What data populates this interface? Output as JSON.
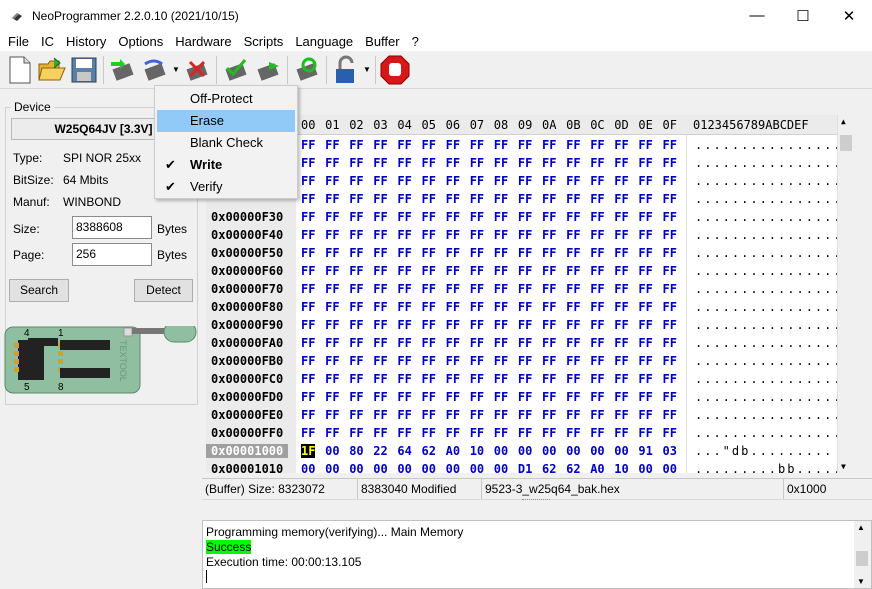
{
  "window": {
    "title": "NeoProgrammer 2.2.0.10 (2021/10/15)",
    "minimize_glyph": "—",
    "maximize_glyph": "☐",
    "close_glyph": "✕"
  },
  "menubar": {
    "items": [
      "File",
      "IC",
      "History",
      "Options",
      "Hardware",
      "Scripts",
      "Language",
      "Buffer",
      "?"
    ]
  },
  "toolbar": {
    "icons": [
      "new-file-icon",
      "open-folder-icon",
      "save-floppy-icon",
      "read-chip-icon",
      "write-chip-icon",
      "erase-chip-icon",
      "verify-chip-icon",
      "blank-check-icon",
      "auto-program-icon",
      "protect-lock-icon",
      "stop-icon"
    ]
  },
  "device": {
    "group_label": "Device",
    "name": "W25Q64JV [3.3V]",
    "type_label": "Type:",
    "type_value": "SPI NOR 25xx",
    "bitsize_label": "BitSize:",
    "bitsize_value": "64 Mbits",
    "manuf_label": "Manuf:",
    "manuf_value": "WINBOND",
    "size_label": "Size:",
    "size_value": "8388608",
    "size_unit": "Bytes",
    "page_label": "Page:",
    "page_value": "256",
    "page_unit": "Bytes",
    "search_label": "Search",
    "detect_label": "Detect",
    "socket_pin_tl": "4",
    "socket_pin_tr": "1",
    "socket_pin_bl": "5",
    "socket_pin_br": "8",
    "socket_brand": "TEXTOOL"
  },
  "dropdown": {
    "items": [
      {
        "label": "Off-Protect",
        "checked": false,
        "highlighted": false,
        "bold": false
      },
      {
        "label": "Erase",
        "checked": false,
        "highlighted": true,
        "bold": false
      },
      {
        "label": "Blank Check",
        "checked": false,
        "highlighted": false,
        "bold": false
      },
      {
        "label": "Write",
        "checked": true,
        "highlighted": false,
        "bold": true
      },
      {
        "label": "Verify",
        "checked": true,
        "highlighted": false,
        "bold": false
      }
    ]
  },
  "hexview": {
    "header_cols": [
      "00",
      "01",
      "02",
      "03",
      "04",
      "05",
      "06",
      "07",
      "08",
      "09",
      "0A",
      "0B",
      "0C",
      "0D",
      "0E",
      "0F"
    ],
    "header_ascii": "0123456789ABCDEF",
    "rows": [
      {
        "addr": "",
        "bytes": [
          "FF",
          "FF",
          "FF",
          "FF",
          "FF",
          "FF",
          "FF",
          "FF",
          "FF",
          "FF",
          "FF",
          "FF",
          "FF",
          "FF",
          "FF",
          "FF"
        ],
        "ascii": "................"
      },
      {
        "addr": "",
        "bytes": [
          "FF",
          "FF",
          "FF",
          "FF",
          "FF",
          "FF",
          "FF",
          "FF",
          "FF",
          "FF",
          "FF",
          "FF",
          "FF",
          "FF",
          "FF",
          "FF"
        ],
        "ascii": "................"
      },
      {
        "addr": "",
        "bytes": [
          "FF",
          "FF",
          "FF",
          "FF",
          "FF",
          "FF",
          "FF",
          "FF",
          "FF",
          "FF",
          "FF",
          "FF",
          "FF",
          "FF",
          "FF",
          "FF"
        ],
        "ascii": "................"
      },
      {
        "addr": "",
        "bytes": [
          "FF",
          "FF",
          "FF",
          "FF",
          "FF",
          "FF",
          "FF",
          "FF",
          "FF",
          "FF",
          "FF",
          "FF",
          "FF",
          "FF",
          "FF",
          "FF"
        ],
        "ascii": "................"
      },
      {
        "addr": "0x00000F30",
        "bytes": [
          "FF",
          "FF",
          "FF",
          "FF",
          "FF",
          "FF",
          "FF",
          "FF",
          "FF",
          "FF",
          "FF",
          "FF",
          "FF",
          "FF",
          "FF",
          "FF"
        ],
        "ascii": "................"
      },
      {
        "addr": "0x00000F40",
        "bytes": [
          "FF",
          "FF",
          "FF",
          "FF",
          "FF",
          "FF",
          "FF",
          "FF",
          "FF",
          "FF",
          "FF",
          "FF",
          "FF",
          "FF",
          "FF",
          "FF"
        ],
        "ascii": "................"
      },
      {
        "addr": "0x00000F50",
        "bytes": [
          "FF",
          "FF",
          "FF",
          "FF",
          "FF",
          "FF",
          "FF",
          "FF",
          "FF",
          "FF",
          "FF",
          "FF",
          "FF",
          "FF",
          "FF",
          "FF"
        ],
        "ascii": "................"
      },
      {
        "addr": "0x00000F60",
        "bytes": [
          "FF",
          "FF",
          "FF",
          "FF",
          "FF",
          "FF",
          "FF",
          "FF",
          "FF",
          "FF",
          "FF",
          "FF",
          "FF",
          "FF",
          "FF",
          "FF"
        ],
        "ascii": "................"
      },
      {
        "addr": "0x00000F70",
        "bytes": [
          "FF",
          "FF",
          "FF",
          "FF",
          "FF",
          "FF",
          "FF",
          "FF",
          "FF",
          "FF",
          "FF",
          "FF",
          "FF",
          "FF",
          "FF",
          "FF"
        ],
        "ascii": "................"
      },
      {
        "addr": "0x00000F80",
        "bytes": [
          "FF",
          "FF",
          "FF",
          "FF",
          "FF",
          "FF",
          "FF",
          "FF",
          "FF",
          "FF",
          "FF",
          "FF",
          "FF",
          "FF",
          "FF",
          "FF"
        ],
        "ascii": "................"
      },
      {
        "addr": "0x00000F90",
        "bytes": [
          "FF",
          "FF",
          "FF",
          "FF",
          "FF",
          "FF",
          "FF",
          "FF",
          "FF",
          "FF",
          "FF",
          "FF",
          "FF",
          "FF",
          "FF",
          "FF"
        ],
        "ascii": "................"
      },
      {
        "addr": "0x00000FA0",
        "bytes": [
          "FF",
          "FF",
          "FF",
          "FF",
          "FF",
          "FF",
          "FF",
          "FF",
          "FF",
          "FF",
          "FF",
          "FF",
          "FF",
          "FF",
          "FF",
          "FF"
        ],
        "ascii": "................"
      },
      {
        "addr": "0x00000FB0",
        "bytes": [
          "FF",
          "FF",
          "FF",
          "FF",
          "FF",
          "FF",
          "FF",
          "FF",
          "FF",
          "FF",
          "FF",
          "FF",
          "FF",
          "FF",
          "FF",
          "FF"
        ],
        "ascii": "................"
      },
      {
        "addr": "0x00000FC0",
        "bytes": [
          "FF",
          "FF",
          "FF",
          "FF",
          "FF",
          "FF",
          "FF",
          "FF",
          "FF",
          "FF",
          "FF",
          "FF",
          "FF",
          "FF",
          "FF",
          "FF"
        ],
        "ascii": "................"
      },
      {
        "addr": "0x00000FD0",
        "bytes": [
          "FF",
          "FF",
          "FF",
          "FF",
          "FF",
          "FF",
          "FF",
          "FF",
          "FF",
          "FF",
          "FF",
          "FF",
          "FF",
          "FF",
          "FF",
          "FF"
        ],
        "ascii": "................"
      },
      {
        "addr": "0x00000FE0",
        "bytes": [
          "FF",
          "FF",
          "FF",
          "FF",
          "FF",
          "FF",
          "FF",
          "FF",
          "FF",
          "FF",
          "FF",
          "FF",
          "FF",
          "FF",
          "FF",
          "FF"
        ],
        "ascii": "................"
      },
      {
        "addr": "0x00000FF0",
        "bytes": [
          "FF",
          "FF",
          "FF",
          "FF",
          "FF",
          "FF",
          "FF",
          "FF",
          "FF",
          "FF",
          "FF",
          "FF",
          "FF",
          "FF",
          "FF",
          "FF"
        ],
        "ascii": "................"
      },
      {
        "addr": "0x00001000",
        "bytes": [
          "1F",
          "00",
          "80",
          "22",
          "64",
          "62",
          "A0",
          "10",
          "00",
          "00",
          "00",
          "00",
          "00",
          "00",
          "91",
          "03"
        ],
        "ascii": "...\"db.........",
        "selected": true
      },
      {
        "addr": "0x00001010",
        "bytes": [
          "00",
          "00",
          "00",
          "00",
          "00",
          "00",
          "00",
          "00",
          "00",
          "D1",
          "62",
          "62",
          "A0",
          "10",
          "00",
          "00"
        ],
        "ascii": ".........bb....."
      }
    ]
  },
  "status": {
    "buffer_size": "(Buffer) Size: 8323072",
    "modified": "8383040 Modified",
    "filename": "9523-3_w25q64_bak.hex",
    "offset": "0x1000"
  },
  "log": {
    "line1": "Programming memory(verifying)... Main Memory",
    "line2": "Success",
    "line3": "Execution time: 00:00:13.105"
  },
  "colors": {
    "hex_byte": "#0000c0",
    "highlight": "#91c9f7",
    "success_bg": "#00ff00",
    "socket_green": "#8fbfa0"
  }
}
